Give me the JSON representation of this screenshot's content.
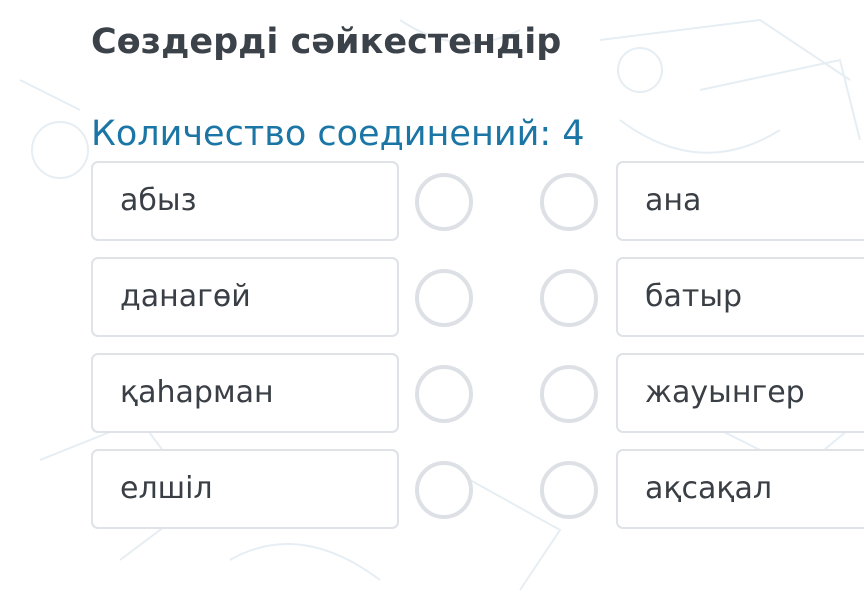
{
  "title": "Сөздерді сәйкестендір",
  "connections": {
    "label": "Количество соединений:",
    "count": "4"
  },
  "left_items": [
    {
      "label": "абыз"
    },
    {
      "label": "данагөй"
    },
    {
      "label": "қаһарман"
    },
    {
      "label": "елшіл"
    }
  ],
  "right_items": [
    {
      "label": "ана"
    },
    {
      "label": "батыр"
    },
    {
      "label": "жауынгер"
    },
    {
      "label": "ақсақал"
    }
  ],
  "colors": {
    "title": "#3c4249",
    "accent": "#1b76a6",
    "box_border": "#dfe2e6",
    "connector_border": "#dde1e6"
  }
}
